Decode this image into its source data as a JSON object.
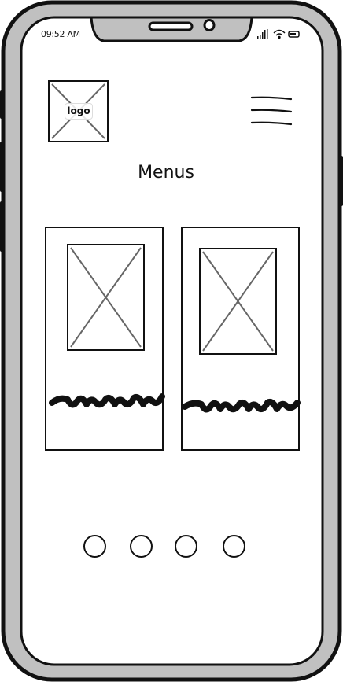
{
  "status_bar": {
    "time": "09:52 AM",
    "icons": [
      "signal-icon",
      "wifi-icon",
      "battery-icon"
    ]
  },
  "header": {
    "logo_label": "logo",
    "menu_icon": "hamburger-menu-icon"
  },
  "page": {
    "title": "Menus"
  },
  "cards": [
    {
      "image": "image-placeholder",
      "text": "scribble-placeholder"
    },
    {
      "image": "image-placeholder",
      "text": "scribble-placeholder"
    }
  ],
  "pagination": {
    "dots": 4
  },
  "colors": {
    "bezel": "#c0c0c0",
    "ink": "#111111",
    "placeholder_cross": "#666666"
  }
}
